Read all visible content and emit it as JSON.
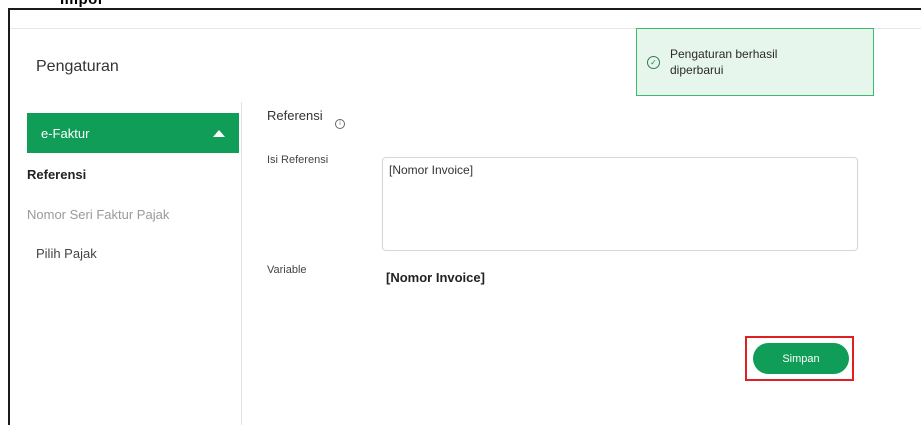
{
  "header": {
    "title_fragment": "Impor",
    "page_title": "Pengaturan"
  },
  "sidebar": {
    "active_menu": "e-Faktur",
    "items": [
      {
        "label": "Referensi",
        "state": "selected"
      },
      {
        "label": "Nomor Seri Faktur Pajak",
        "state": "muted"
      },
      {
        "label": "Pilih Pajak",
        "state": "normal"
      }
    ]
  },
  "main": {
    "section_title": "Referensi",
    "isi_label": "Isi Referensi",
    "isi_value": "[Nomor Invoice]",
    "variable_label": "Variable",
    "variable_value": "[Nomor Invoice]",
    "save_label": "Simpan"
  },
  "toast": {
    "message": "Pengaturan berhasil diperbarui",
    "icon": "check-circle-icon"
  },
  "colors": {
    "accent": "#0f9d58",
    "highlight": "#e02020",
    "toast_bg": "#e7f6ec",
    "toast_border": "#3cba6e"
  }
}
